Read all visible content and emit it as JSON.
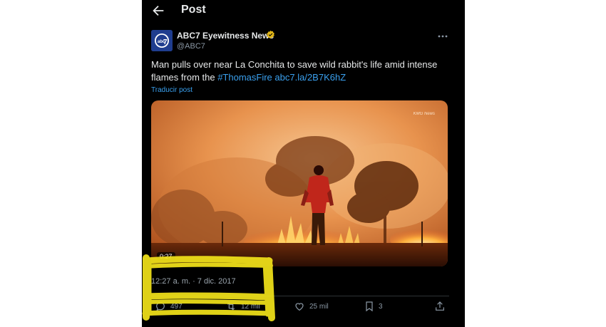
{
  "header": {
    "title": "Post"
  },
  "tweet": {
    "author": {
      "name": "ABC7 Eyewitness News",
      "handle": "@ABC7",
      "avatar_text": "abc7"
    },
    "text_plain": "Man pulls over near La Conchita to save wild rabbit's life amid intense flames from the ",
    "hashtag": "#ThomasFire",
    "link": "abc7.la/2B7K6hZ",
    "translate_label": "Traducir post",
    "media": {
      "watermark": "KMG News",
      "duration": "0:27"
    },
    "timestamp": "12:27 a. m. · 7 dic. 2017",
    "actions": {
      "replies": "497",
      "reposts": "12 mil",
      "likes": "25 mil",
      "bookmarks": "3"
    }
  },
  "colors": {
    "background": "#000000",
    "accent_link": "#3aa0ee",
    "highlight_marker": "#f2e31a"
  }
}
